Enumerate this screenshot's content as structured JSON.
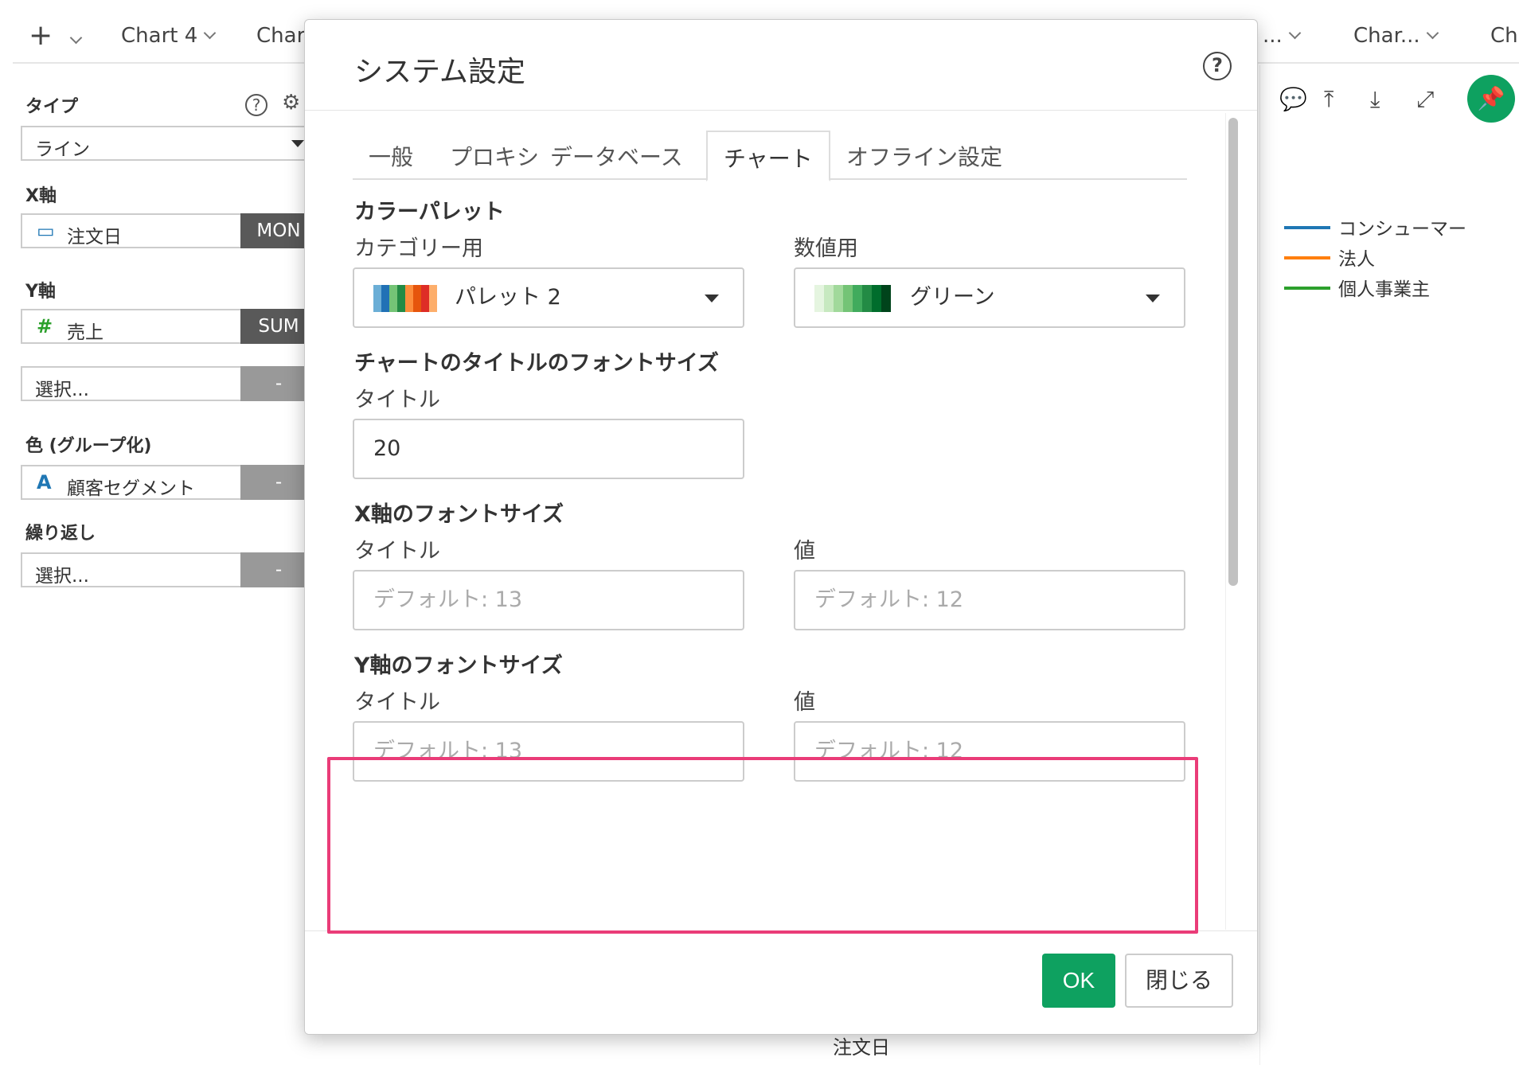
{
  "topbar": {
    "add_symbol": "+",
    "tabs": [
      "Chart 4",
      "Chart",
      "...",
      "Char...",
      "Ch"
    ]
  },
  "left_panel": {
    "type_label": "タイプ",
    "type_value": "ライン",
    "x_axis_label": "X軸",
    "x_field": "注文日",
    "x_agg": "MON",
    "y_axis_label": "Y軸",
    "y_field_icon": "#",
    "y_field": "売上",
    "y_agg": "SUM",
    "y2_placeholder": "選択...",
    "y2_agg": "-",
    "color_label": "色 (グループ化)",
    "color_field_icon": "A",
    "color_field": "顧客セグメント",
    "color_agg": "-",
    "repeat_label": "繰り返し",
    "repeat_placeholder": "選択...",
    "repeat_agg": "-"
  },
  "legend": {
    "items": [
      {
        "label": "コンシューマー",
        "color": "#1f77b4"
      },
      {
        "label": "法人",
        "color": "#ff7f0e"
      },
      {
        "label": "個人事業主",
        "color": "#2ca02c"
      }
    ]
  },
  "chart_bg": {
    "x_axis_title": "注文日"
  },
  "modal": {
    "title": "システム設定",
    "help_symbol": "?",
    "tabs": [
      {
        "label": "一般",
        "active": false
      },
      {
        "label": "プロキシ",
        "active": false
      },
      {
        "label": "データベース",
        "active": false
      },
      {
        "label": "チャート",
        "active": true
      },
      {
        "label": "オフライン設定",
        "active": false
      }
    ],
    "color_palette": {
      "section_title": "カラーパレット",
      "category_label": "カテゴリー用",
      "category_value": "パレット 2",
      "category_colors": [
        "#6baed6",
        "#2171b5",
        "#74c476",
        "#238b45",
        "#fd8d3c",
        "#e6550d",
        "#de2d26",
        "#fdae6b"
      ],
      "numeric_label": "数値用",
      "numeric_value": "グリーン",
      "numeric_colors": [
        "#e5f5e0",
        "#c7e9c0",
        "#a1d99b",
        "#74c476",
        "#41ab5d",
        "#238b45",
        "#006d2c",
        "#00441b"
      ]
    },
    "title_font": {
      "section_title": "チャートのタイトルのフォントサイズ",
      "title_label": "タイトル",
      "title_value": "20"
    },
    "x_axis_font": {
      "section_title": "X軸のフォントサイズ",
      "title_label": "タイトル",
      "title_placeholder": "デフォルト: 13",
      "value_label": "値",
      "value_placeholder": "デフォルト: 12"
    },
    "y_axis_font": {
      "section_title": "Y軸のフォントサイズ",
      "title_label": "タイトル",
      "title_placeholder": "デフォルト: 13",
      "value_label": "値",
      "value_placeholder": "デフォルト: 12"
    },
    "ok_label": "OK",
    "close_label": "閉じる"
  },
  "colors": {
    "accent": "#0ea160",
    "highlight": "#ea3c78"
  }
}
